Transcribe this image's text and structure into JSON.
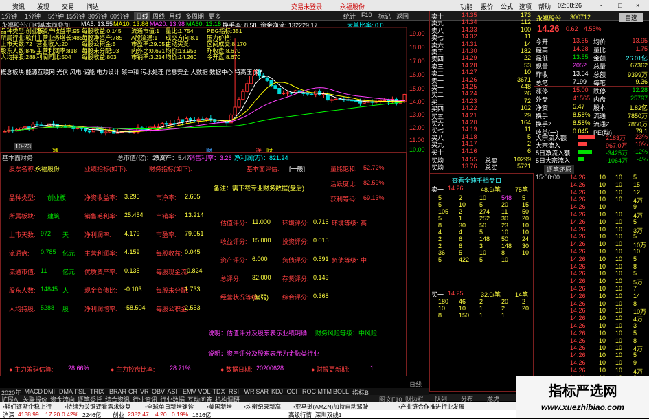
{
  "menu": {
    "items": [
      "资讯",
      "发现",
      "交易",
      "问达"
    ],
    "center": [
      "交易未登录",
      "永福股份"
    ],
    "right": [
      "功能",
      "报价",
      "公式",
      "选项",
      "帮助"
    ],
    "time": "02:08:26",
    "win_btns": [
      "-",
      "□",
      "×"
    ]
  },
  "period_tabs": [
    "1分钟",
    "1分钟",
    "5分钟",
    "15分钟",
    "30分钟",
    "60分钟",
    "日线",
    "周线",
    "月线",
    "多周期",
    "更多"
  ],
  "right_tabs": [
    "统计",
    "F10",
    "标记",
    "返回"
  ],
  "chart_head": {
    "stock": "永福股份(日线)",
    "indicator": "基本面叠加",
    "ma": [
      {
        "label": "MA5: 13.55",
        "color": "#ffffff"
      },
      {
        "label": "MA10: 13.86",
        "color": "#ffff00"
      },
      {
        "label": "MA20: 13.98",
        "color": "#ff40ff"
      },
      {
        "label": "MA60: 13.18",
        "color": "#00ff00"
      }
    ],
    "turnover": "换手率: 8.58",
    "net": "资金净流: 132229.17",
    "gain": "大单比率: 0.0"
  },
  "price_axis": [
    "19.00",
    "18.00",
    "17.00",
    "16.00",
    "15.00",
    "14.00",
    "13.00",
    "12.00",
    "11.00",
    "10.00"
  ],
  "overlay_info": [
    "品种类型:创业板",
    "净资产收益率:95",
    "每股收益:0.145",
    "流通市值:1",
    "量比:1.754",
    "PEG指标:351",
    "所属行业:软件",
    "主营业务增长:485",
    "每股净资产:785",
    "A股流通:1",
    "成交方向:8.1",
    "压力价格:",
    "上市天数:72",
    "营业收入:20",
    "每股公积金:5",
    "市盈率:29.051",
    "主动买卖:",
    "区间成交:8.170",
    "股东人数:845",
    "主营利润率:818",
    "每股未分配:03",
    "内外比:0.621",
    "均价:13.953",
    "昨收盘:8.670",
    "人均持股:288",
    "利润同比:504",
    "每股收益:803",
    "市销率:3.214",
    "均价:14.260",
    "今开盘:8.670"
  ],
  "concepts": "概念板块:能源互联网 光伏 风电 储能 电力设计 碳中和 污水处理 信息安全 大数据 数据中心 特高压 资产重组 资源",
  "markers": {
    "dates": [
      "10-23"
    ],
    "tags": [
      {
        "t": "减",
        "c": "#ffff00"
      },
      {
        "t": "财",
        "c": "#40a0ff"
      },
      {
        "t": "送",
        "c": "#ff4040"
      },
      {
        "t": "财",
        "c": "#ffff00"
      }
    ]
  },
  "chart_data": {
    "type": "candlestick",
    "x_count": 100,
    "ylim": [
      10.0,
      19.6
    ],
    "peak": 18.9,
    "last_close": 14.26
  },
  "fund_head": {
    "title": "基本面财务",
    "items": [
      "总市值(亿)：25.97",
      "净资产：5.47",
      "销售利率：3.26",
      "净利润(万)：821.24"
    ]
  },
  "fund": {
    "row1": {
      "k1": "股票名称:",
      "v1": "永福股份",
      "k2": "业绩指标(如下):",
      "k3": "财务指标(如下):",
      "k4": "基本面评估:",
      "v4": "[一般]",
      "k5": "量能饱和:",
      "v5": "52.72%"
    },
    "row2": {
      "k": "活跃度比:",
      "v": "82.59%"
    },
    "note": "备注：需下载专业财务数据(盘后)",
    "row3": {
      "k": "获利筹码:",
      "v": "69.13%"
    },
    "rows": [
      {
        "k1": "品种类型:",
        "v1": "创业板",
        "k2": "净资收益率:",
        "v2": "3.295",
        "k3": "市净率:",
        "v3": "2.605"
      },
      {
        "k1": "所属板块:",
        "v1": "建筑",
        "k2": "销售毛利率:",
        "v2": "25.454",
        "k3": "市销率:",
        "v3": "13.214"
      },
      {
        "k1": "上市天数:",
        "v1": "972",
        "u1": "天",
        "k2": "净利润率:",
        "v2": "4.179",
        "k3": "市盈率:",
        "v3": "79.051"
      },
      {
        "k1": "流通盘:",
        "v1": "0.785",
        "u1": "亿元",
        "k2": "主营利润率:",
        "v2": "4.159",
        "k3": "每股收益:",
        "v3": "0.045"
      },
      {
        "k1": "流通市值:",
        "v1": "11",
        "u1": "亿元",
        "k2": "优质资产率:",
        "v2": "0.135",
        "k3": "每股现金流:",
        "v3": "-0.824"
      },
      {
        "k1": "股东人数:",
        "v1": "14845",
        "u1": "人",
        "k2": "现金负债比:",
        "v2": "-0.103",
        "k3": "每股未分配:",
        "v3": "1.733"
      },
      {
        "k1": "人均持股:",
        "v1": "5288",
        "u1": "股",
        "k2": "净利润增率:",
        "v2": "-58.504",
        "k3": "每股公积金:",
        "v3": "2.553"
      }
    ],
    "eval": [
      {
        "k": "估值评分:",
        "v": "11.000",
        "k2": "环境评分:",
        "v2": "0.716",
        "k3": "环境等级:",
        "v3": "高"
      },
      {
        "k": "收益评分:",
        "v": "15.000",
        "k2": "投资评分:",
        "v2": "0.015"
      },
      {
        "k": "资产评分:",
        "v": "6.000",
        "k2": "负债评分:",
        "v2": "0.591",
        "k3": "负债等级:",
        "v3": "中"
      },
      {
        "k": "总评分:",
        "v": "32.000",
        "k2": "存货评分:",
        "v2": "0.149"
      },
      {
        "k": "经营状况等级:",
        "v": "(偏弱)",
        "k2": "综合评分:",
        "v2": "0.368"
      }
    ],
    "note2": "说明：估值评分及股东表示业绩明确",
    "risk": "财务风险等级：中风险",
    "note3": "说明：资产评分及股东表示为金融类行业",
    "bottom": [
      {
        "k": "主力筹码估算:",
        "v": "28.66%"
      },
      {
        "k": "主力控盘比率:",
        "v": "28.71%"
      },
      {
        "k": "数据日期:",
        "v": "20200628"
      },
      {
        "k": "财报更新期:",
        "v": "1"
      }
    ]
  },
  "ind_tabs": [
    "2020年",
    "MACD",
    "DMI",
    "DMA",
    "FSL",
    "TRIX",
    "BRAR",
    "CR",
    "VR",
    "OBV",
    "ASI",
    "EMV",
    "VOL-TDX",
    "RSI",
    "WR",
    "SAR",
    "KDJ",
    "CCI",
    "ROC",
    "MTM",
    "BOLL",
    "指标B"
  ],
  "sub_tabs": [
    "扩展A",
    "关联报价",
    "资金流向",
    "逐笔委托",
    "综合资讯",
    "行业资讯",
    "行业数据",
    "互动问答",
    "机构调研"
  ],
  "quote_head": {
    "name": "永福股份",
    "code": "300712",
    "btn": "自选"
  },
  "quote": {
    "price": "14.26",
    "chg": "0.62",
    "pct": "4.55%"
  },
  "ask": [
    {
      "l": "卖十",
      "p": "14.35",
      "v": "173"
    },
    {
      "l": "卖九",
      "p": "14.34",
      "v": "112"
    },
    {
      "l": "卖八",
      "p": "14.33",
      "v": "100"
    },
    {
      "l": "卖七",
      "p": "14.32",
      "v": "11"
    },
    {
      "l": "卖六",
      "p": "14.31",
      "v": "14"
    },
    {
      "l": "卖五",
      "p": "14.30",
      "v": "182"
    },
    {
      "l": "卖四",
      "p": "14.29",
      "v": "22"
    },
    {
      "l": "卖三",
      "p": "14.28",
      "v": "53"
    },
    {
      "l": "卖二",
      "p": "14.27",
      "v": "10"
    },
    {
      "l": "卖一",
      "p": "14.26",
      "v": "3671"
    }
  ],
  "bid": [
    {
      "l": "买一",
      "p": "14.25",
      "v": "448"
    },
    {
      "l": "买二",
      "p": "14.24",
      "v": "26"
    },
    {
      "l": "买三",
      "p": "14.23",
      "v": "72"
    },
    {
      "l": "买四",
      "p": "14.22",
      "v": "102"
    },
    {
      "l": "买五",
      "p": "14.21",
      "v": "29"
    },
    {
      "l": "买六",
      "p": "14.20",
      "v": "164"
    },
    {
      "l": "买七",
      "p": "14.19",
      "v": "11"
    },
    {
      "l": "买八",
      "p": "14.18",
      "v": "5"
    },
    {
      "l": "买九",
      "p": "14.17",
      "v": "2"
    },
    {
      "l": "买十",
      "p": "14.16",
      "v": "6"
    }
  ],
  "avg": [
    {
      "l": "买均",
      "p": "14.55",
      "k": "总卖",
      "v": "10299"
    },
    {
      "l": "买均",
      "p": "13.76",
      "k": "总买",
      "v": "5721"
    }
  ],
  "stats": [
    {
      "k1": "今开",
      "v1": "13.65",
      "c1": "#ff4040",
      "k2": "均价",
      "v2": "13.95",
      "c2": "#ff4040"
    },
    {
      "k1": "最高",
      "v1": "14.28",
      "c1": "#ff4040",
      "k2": "量比",
      "v2": "1.75",
      "c2": "#ff4040"
    },
    {
      "k1": "最低",
      "v1": "13.55",
      "c1": "#00e000",
      "k2": "金额",
      "v2": "26.01亿",
      "c2": "#40ffff"
    },
    {
      "k1": "现量",
      "v1": "2052",
      "c1": "#ff40ff",
      "k2": "总量",
      "v2": "67362",
      "c2": "#ffff40"
    },
    {
      "k1": "昨收",
      "v1": "13.64",
      "c1": "#ffffff",
      "k2": "总额",
      "v2": "9399万",
      "c2": "#ffff40"
    },
    {
      "k1": "总笔",
      "v1": "7199",
      "c1": "#ffffff",
      "k2": "每笔",
      "v2": "9.36",
      "c2": "#ffff40"
    },
    {
      "k1": "涨停",
      "v1": "15.00",
      "c1": "#ff4040",
      "k2": "跌停",
      "v2": "12.28",
      "c2": "#00e000"
    },
    {
      "k1": "外盘",
      "v1": "41565",
      "c1": "#ff4040",
      "k2": "内盘",
      "v2": "25797",
      "c2": "#00e000"
    },
    {
      "k1": "净资",
      "v1": "5.47",
      "c1": "#ffff40",
      "k2": "股本",
      "v2": "1.82亿",
      "c2": "#ffff40"
    },
    {
      "k1": "换手",
      "v1": "8.58%",
      "c1": "#ffff40",
      "k2": "流通",
      "v2": "7850万",
      "c2": "#ffff40"
    },
    {
      "k1": "换手Z",
      "v1": "8.58%",
      "c1": "#ffff40",
      "k2": "流通Z",
      "v2": "7850万",
      "c2": "#ffff40"
    },
    {
      "k1": "收益(一)",
      "v1": "0.045",
      "c1": "#ffff40",
      "k2": "PE(动)",
      "v2": "79.1",
      "c2": "#ffff40"
    }
  ],
  "flows": [
    {
      "k": "大宗流入额",
      "v": "2183万",
      "p": "23%",
      "c": "#ff4040",
      "w": 0.6
    },
    {
      "k": "大宗流入",
      "v": "967.0万",
      "p": "10%",
      "c": "#ff4040",
      "w": 0.3
    },
    {
      "k": "5日净流入额",
      "v": "-3425万",
      "p": "-12%",
      "c": "#00e000",
      "w": 0.5
    },
    {
      "k": "5日大宗流入",
      "v": "-1064万",
      "p": "-4%",
      "c": "#00e000",
      "w": 0.2
    }
  ],
  "ticks_head": "逐笔还原",
  "ticks": [
    {
      "t": "15:00:00",
      "p": "14.26",
      "v": "10",
      "v2": "10",
      "e": "5"
    },
    {
      "t": "",
      "p": "14.26",
      "v": "10",
      "v2": "10",
      "e": "15"
    },
    {
      "t": "",
      "p": "14.26",
      "v": "10",
      "v2": "10",
      "e": "12"
    },
    {
      "t": "",
      "p": "14.26",
      "v": "10",
      "v2": "10",
      "e": "4万"
    },
    {
      "t": "",
      "p": "14.26",
      "v": "10",
      "v2": "",
      "e": "9"
    },
    {
      "t": "",
      "p": "14.26",
      "v": "10",
      "v2": "10",
      "e": "4万"
    },
    {
      "t": "",
      "p": "14.26",
      "v": "10",
      "v2": "10",
      "e": "5"
    },
    {
      "t": "",
      "p": "14.26",
      "v": "10",
      "v2": "10",
      "e": "3万"
    },
    {
      "t": "",
      "p": "14.26",
      "v": "10",
      "v2": "10",
      "e": "5"
    },
    {
      "t": "",
      "p": "14.26",
      "v": "10",
      "v2": "10",
      "e": "10万"
    },
    {
      "t": "",
      "p": "14.26",
      "v": "10",
      "v2": "10",
      "e": "10"
    },
    {
      "t": "",
      "p": "14.26",
      "v": "10",
      "v2": "10",
      "e": "5"
    },
    {
      "t": "",
      "p": "14.26",
      "v": "10",
      "v2": "10",
      "e": "8"
    },
    {
      "t": "",
      "p": "14.26",
      "v": "10",
      "v2": "10",
      "e": "5"
    },
    {
      "t": "",
      "p": "14.26",
      "v": "10",
      "v2": "10",
      "e": "5万"
    },
    {
      "t": "",
      "p": "14.26",
      "v": "10",
      "v2": "10",
      "e": "7"
    },
    {
      "t": "",
      "p": "14.26",
      "v": "10",
      "v2": "10",
      "e": "14"
    },
    {
      "t": "",
      "p": "14.26",
      "v": "10",
      "v2": "10",
      "e": "8"
    },
    {
      "t": "",
      "p": "14.26",
      "v": "10",
      "v2": "10",
      "e": "10万"
    },
    {
      "t": "",
      "p": "14.26",
      "v": "10",
      "v2": "10",
      "e": "4万"
    },
    {
      "t": "",
      "p": "14.26",
      "v": "10",
      "v2": "10",
      "e": "3"
    },
    {
      "t": "",
      "p": "14.26",
      "v": "10",
      "v2": "10",
      "e": "5"
    },
    {
      "t": "",
      "p": "14.26",
      "v": "10",
      "v2": "10",
      "e": "8"
    },
    {
      "t": "",
      "p": "14.26",
      "v": "10",
      "v2": "10",
      "e": "4万"
    },
    {
      "t": "",
      "p": "14.26",
      "v": "10",
      "v2": "10",
      "e": "5"
    },
    {
      "t": "",
      "p": "14.26",
      "v": "10",
      "v2": "10",
      "e": "9"
    },
    {
      "t": "",
      "p": "14.26",
      "v": "10",
      "v2": "10",
      "e": "4万"
    },
    {
      "t": "",
      "p": "14.26",
      "v": "10",
      "v2": "10",
      "e": "8"
    },
    {
      "t": "",
      "p": "14.26",
      "v": "10",
      "v2": "10",
      "e": "3"
    }
  ],
  "mid": {
    "sell_title": "查看全速千档盘口",
    "sell_head": {
      "l": "卖一",
      "p": "14.26",
      "q": "48.9/笔",
      "n": "75笔"
    },
    "sell_rows": [
      [
        "5",
        "2",
        "10",
        "548",
        "5"
      ],
      [
        "5",
        "10",
        "5",
        "20",
        "15"
      ],
      [
        "105",
        "2",
        "274",
        "11",
        "50"
      ],
      [
        "5",
        "1",
        "252",
        "30",
        "20"
      ],
      [
        "8",
        "30",
        "50",
        "23",
        "10"
      ],
      [
        "4",
        "4",
        "5",
        "10",
        "10"
      ],
      [
        "2",
        "6",
        "148",
        "50",
        "24"
      ],
      [
        "2",
        "6",
        "3",
        "148",
        "30"
      ],
      [
        "36",
        "5",
        "10",
        "8",
        "10"
      ],
      [
        "5",
        "422",
        "5",
        "10",
        ""
      ]
    ],
    "buy_head": {
      "l": "买一",
      "p": "14.25",
      "q": "32.0/笔",
      "n": "14笔"
    },
    "buy_rows": [
      [
        "180",
        "46",
        "2",
        "20",
        "2"
      ],
      [
        "10",
        "10",
        "1",
        "2",
        "20"
      ],
      [
        "8",
        "150",
        "1",
        "1",
        ""
      ]
    ]
  },
  "bottom_tabs": {
    "left": "日线",
    "mid": [
      "图文F10",
      "财边栏"
    ],
    "right": [
      "队列",
      "分布",
      "龙虎"
    ]
  },
  "ticker": [
    "辅们逐渐企稳上行",
    "持续为关键迂看需求恢复",
    "全球单日新增确诊",
    "美国新增",
    "均衡纪录新高",
    "亚马逊(AMZN)加持自动驾驶",
    "产业链合作推进行业发展"
  ],
  "index": [
    {
      "n": "沪深",
      "v": "4138.99",
      "c": "17.20",
      "p": "0.42%",
      "a": "2246亿"
    },
    {
      "n": "创业",
      "v": "2382.47",
      "c": "4.20",
      "p": "0.19%",
      "a": "1616亿"
    }
  ],
  "status": "高级行情_深圳双线1",
  "watermark": {
    "title": "指标严选网",
    "url": "www.xuezhibiao.com"
  }
}
